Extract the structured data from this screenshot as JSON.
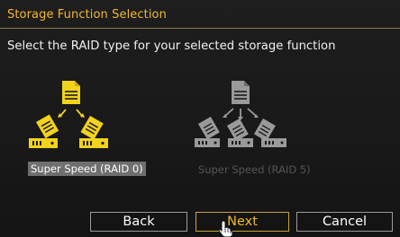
{
  "dialog": {
    "title": "Storage Function Selection",
    "subtitle": "Select the RAID type for your selected storage function"
  },
  "options": [
    {
      "label": "Super Speed (RAID 0)",
      "selected": true,
      "color": "#f3d21e"
    },
    {
      "label": "Super Speed (RAID 5)",
      "selected": false,
      "color": "#9a9a9a"
    }
  ],
  "buttons": {
    "back": "Back",
    "next": "Next",
    "cancel": "Cancel"
  },
  "colors": {
    "accent": "#f2b830",
    "highlight": "#6f6f6f"
  }
}
